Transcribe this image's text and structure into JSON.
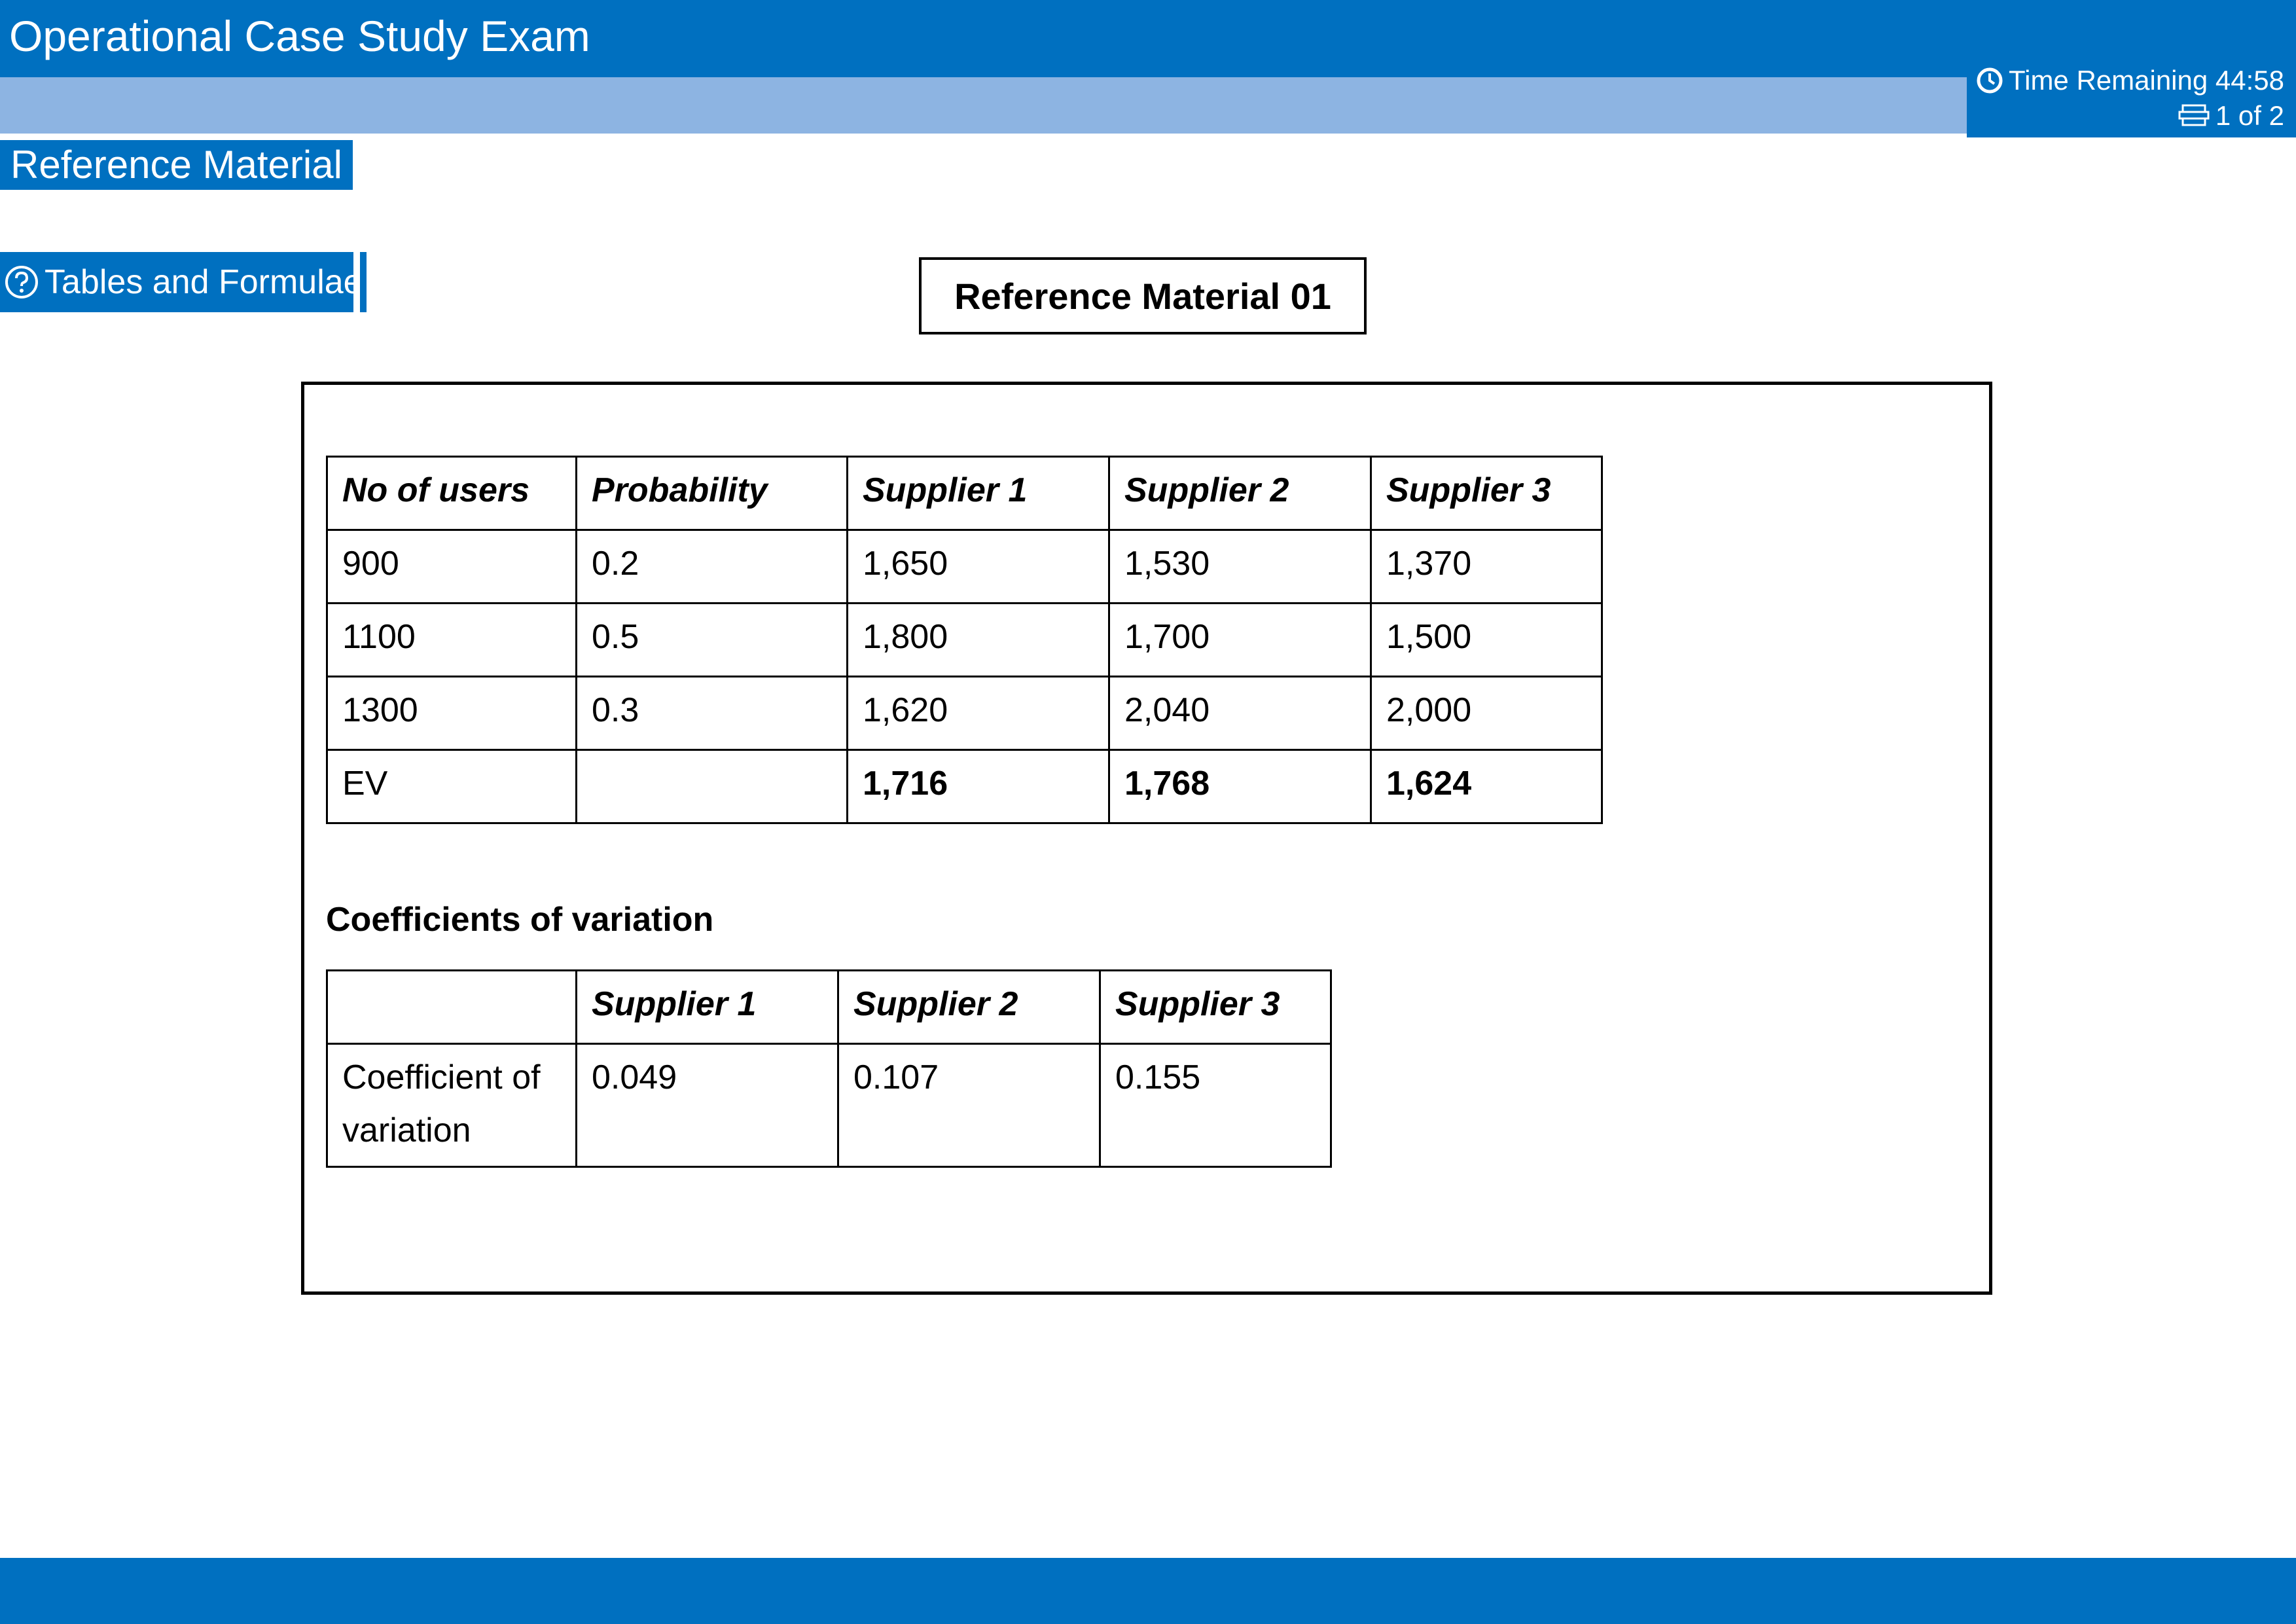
{
  "app": {
    "title": "Operational Case Study Exam"
  },
  "status": {
    "time_remaining": "Time Remaining 44:58",
    "page_indicator": "1 of 2"
  },
  "section": {
    "title": "Reference Material"
  },
  "toolbar": {
    "tables_label": "Tables and Formulae"
  },
  "material": {
    "header": "Reference Material 01"
  },
  "ev_table": {
    "headers": [
      "No of users",
      "Probability",
      "Supplier 1",
      "Supplier 2",
      "Supplier 3"
    ],
    "rows": [
      [
        "900",
        "0.2",
        "1,650",
        "1,530",
        "1,370"
      ],
      [
        "1100",
        "0.5",
        "1,800",
        "1,700",
        "1,500"
      ],
      [
        "1300",
        "0.3",
        "1,620",
        "2,040",
        "2,000"
      ],
      [
        "EV",
        "",
        "1,716",
        "1,768",
        "1,624"
      ]
    ]
  },
  "cv_section": {
    "title": "Coefficients of variation",
    "headers": [
      "",
      "Supplier 1",
      "Supplier 2",
      "Supplier 3"
    ],
    "rows": [
      [
        "Coefficient of variation",
        "0.049",
        "0.107",
        "0.155"
      ]
    ]
  },
  "colors": {
    "primary_blue": "#0070c0",
    "light_blue": "#8db4e2",
    "background": "#ffffff",
    "text": "#000000"
  },
  "icons": {
    "timer": "clock-icon",
    "pager": "document-stack-icon",
    "help": "question-circle-icon"
  }
}
